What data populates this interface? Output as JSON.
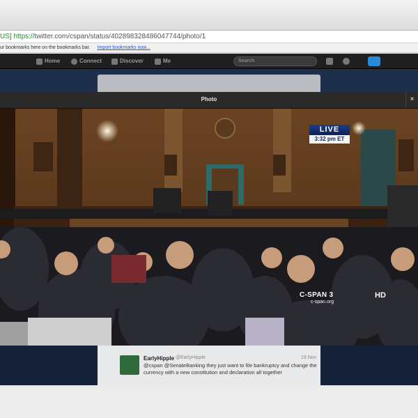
{
  "browser": {
    "address": {
      "badge": "US]",
      "protocol": "https://",
      "rest": "twitter.com/cspan/status/402898328486047744/photo/1"
    },
    "bookmarks": {
      "prompt": "ur bookmarks here on the bookmarks bar.",
      "import_link": "Import bookmarks now..."
    }
  },
  "twitter_nav": {
    "home": "Home",
    "connect": "Connect",
    "discover": "Discover",
    "me": "Me",
    "search_placeholder": "Search"
  },
  "overlay": {
    "title": "Photo",
    "close": "×"
  },
  "photo": {
    "live_label": "LIVE",
    "live_time": "3:32 pm ET",
    "channel": "C-SPAN 3",
    "channel_url": "c-span.org",
    "quality": "HD"
  },
  "tweet": {
    "name": "EarlyHipple",
    "handle": "@EarlyHipple",
    "time": "19 Nov",
    "text": "@cspan @SenateBanking they just want to file bankruptcy and change the currency with a new constitution and declaration all together"
  }
}
